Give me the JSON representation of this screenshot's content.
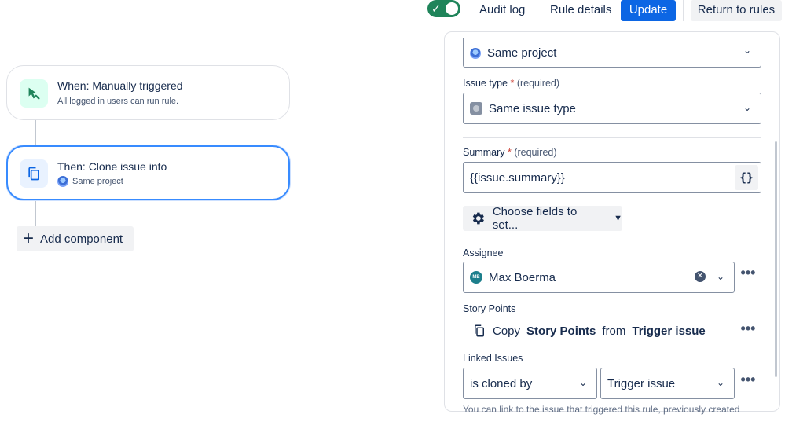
{
  "header": {
    "toggle_on": true,
    "audit_log_label": "Audit log",
    "rule_details_label": "Rule details",
    "update_label": "Update",
    "return_label": "Return to rules"
  },
  "canvas": {
    "trigger": {
      "title": "When: Manually triggered",
      "subtitle": "All logged in users can run rule.",
      "icon": "cursor-icon"
    },
    "action": {
      "title": "Then: Clone issue into",
      "subtitle": "Same project",
      "icon": "copy-icon"
    },
    "add_component_label": "Add component"
  },
  "panel": {
    "project_value": "Same project",
    "issue_type": {
      "label": "Issue type",
      "required_star": "*",
      "required_text": "(required)",
      "value": "Same issue type"
    },
    "summary": {
      "label": "Summary",
      "required_star": "*",
      "required_text": "(required)",
      "value": "{{issue.summary}}",
      "smart_value_button": "{}"
    },
    "choose_fields_label": "Choose fields to set...",
    "assignee": {
      "label": "Assignee",
      "value": "Max Boerma",
      "avatar_initials": "MB"
    },
    "story_points": {
      "label": "Story Points",
      "copy_prefix": "Copy",
      "field": "Story Points",
      "from_text": "from",
      "source": "Trigger issue"
    },
    "linked_issues": {
      "label": "Linked Issues",
      "link_type": "is cloned by",
      "target": "Trigger issue",
      "help": "You can link to the issue that triggered this rule, previously created"
    }
  },
  "colors": {
    "primary": "#0c66e4",
    "toggle": "#1f845a",
    "focus_border": "#388bff",
    "required": "#c9372c"
  }
}
